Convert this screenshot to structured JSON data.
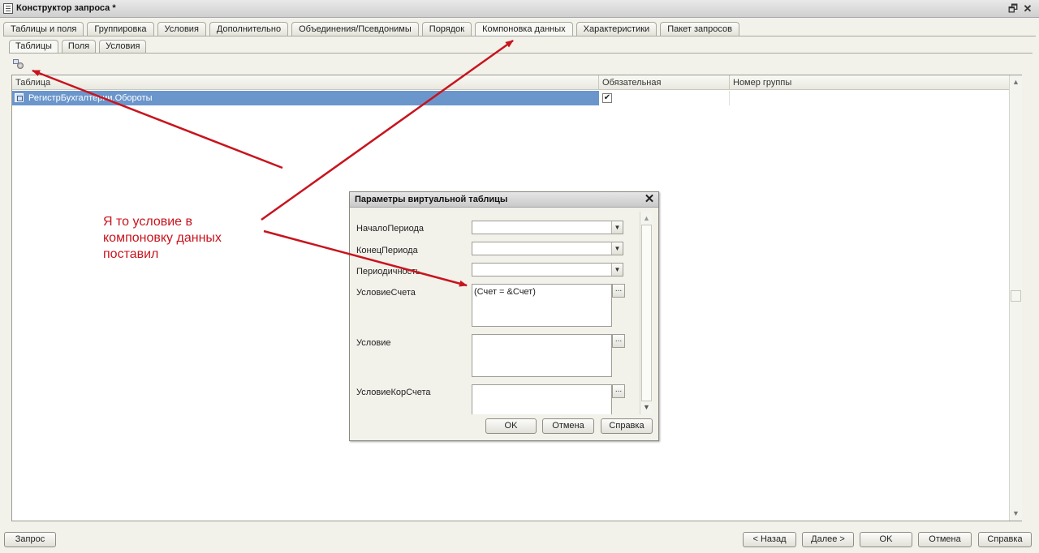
{
  "window": {
    "title": "Конструктор запроса *",
    "restore_glyph": "🗗",
    "close_glyph": "✕"
  },
  "tabs": [
    {
      "label": "Таблицы и поля"
    },
    {
      "label": "Группировка"
    },
    {
      "label": "Условия"
    },
    {
      "label": "Дополнительно"
    },
    {
      "label": "Объединения/Псевдонимы"
    },
    {
      "label": "Порядок"
    },
    {
      "label": "Компоновка данных"
    },
    {
      "label": "Характеристики"
    },
    {
      "label": "Пакет запросов"
    }
  ],
  "active_tab": "Компоновка данных",
  "subtabs": [
    {
      "label": "Таблицы"
    },
    {
      "label": "Поля"
    },
    {
      "label": "Условия"
    }
  ],
  "grid": {
    "columns": [
      "Таблица",
      "Обязательная",
      "Номер группы"
    ],
    "rows": [
      {
        "table": "РегистрБухгалтерии.Обороты",
        "required": true,
        "group": ""
      }
    ],
    "check_glyph": "✔",
    "scroll_up": "▲",
    "scroll_down": "▼"
  },
  "bottom_buttons": {
    "query": "Запрос",
    "back": "< Назад",
    "next": "Далее >",
    "ok": "OK",
    "cancel": "Отмена",
    "help": "Справка"
  },
  "dialog": {
    "title": "Параметры виртуальной таблицы",
    "close_glyph": "✕",
    "fields": {
      "start_period": {
        "label": "НачалоПериода",
        "value": ""
      },
      "end_period": {
        "label": "КонецПериода",
        "value": ""
      },
      "periodicity": {
        "label": "Периодичность",
        "value": ""
      },
      "account_condition": {
        "label": "УсловиеСчета",
        "value": "(Счет = &Счет)"
      },
      "condition": {
        "label": "Условие",
        "value": ""
      },
      "corr_account_condition": {
        "label": "УсловиеКорСчета",
        "value": ""
      }
    },
    "combo_glyph": "▼",
    "ellipsis": "...",
    "buttons": {
      "ok": "OK",
      "cancel": "Отмена",
      "help": "Справка"
    }
  },
  "annotation": {
    "text": "Я то условие в\nкомпоновку данных\nпоставил",
    "color": "#c8141e"
  },
  "colors": {
    "selection": "#6b96cc",
    "arrow": "#c8141e"
  }
}
